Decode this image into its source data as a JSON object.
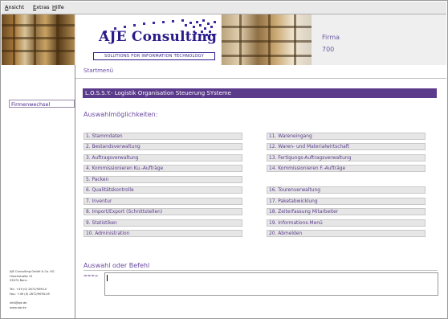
{
  "menubar": {
    "items": [
      {
        "label": "Ansicht",
        "access": "A"
      },
      {
        "label": "Extras",
        "access": "E"
      },
      {
        "label": "Hilfe",
        "access": "H"
      }
    ]
  },
  "header": {
    "logo_title": "AJE Consulting",
    "logo_subtitle": "SOLUTIONS FOR INFORMATION TECHNOLOGY",
    "firma_label": "Firma",
    "firma_number": "700"
  },
  "sidebar": {
    "button_label": "Firmenwechsel",
    "address_lines": [
      "AJE Consulting GmbH & Co. KG",
      "Hirschstraße 12",
      "53074 Bonn",
      "",
      "Tel.: +49 (0) 2672/9094-0",
      "Fax.: +49 (0) 2672/9094-05",
      "",
      "info@aje.de",
      "www.aje.de"
    ]
  },
  "main": {
    "breadcrumb": "Startmenü",
    "banner": "L.O.S.S.Y.- Logistik Organisation Steuerung SYsteme",
    "heading": "Auswahlmöglichkeiten:",
    "options_left": [
      "1.  Stammdaten",
      "2.  Bestandsverwaltung",
      "3.  Auftragsverwaltung",
      "4.  Kommissionieren Ku.-Aufträge",
      "5.  Packen",
      "6.  Qualitätskontrolle",
      "7.  Inventur",
      "8.  Import/Export (Schnittstellen)",
      "9.  Statistiken",
      "10.  Administration"
    ],
    "options_right": [
      "11.  Wareneingang",
      "12.  Waren- und Materialwirtschaft",
      "13.  Fertigungs-Auftragsverwaltung",
      "14.  Kommissionieren F.-Aufträge",
      "16.  Tourenverwaltung",
      "17.  Paketabwicklung",
      "18.  Zeiterfassung Mitarbeiter",
      "19.  Informations-Menü",
      "20.  Abmelden"
    ],
    "command_heading": "Auswahl oder Befehl",
    "prompt": "===>",
    "command_value": ""
  },
  "colors": {
    "banner": "#5a3a8a",
    "text_accent": "#6a4aa0",
    "option_bg": "#e6e6e6"
  }
}
